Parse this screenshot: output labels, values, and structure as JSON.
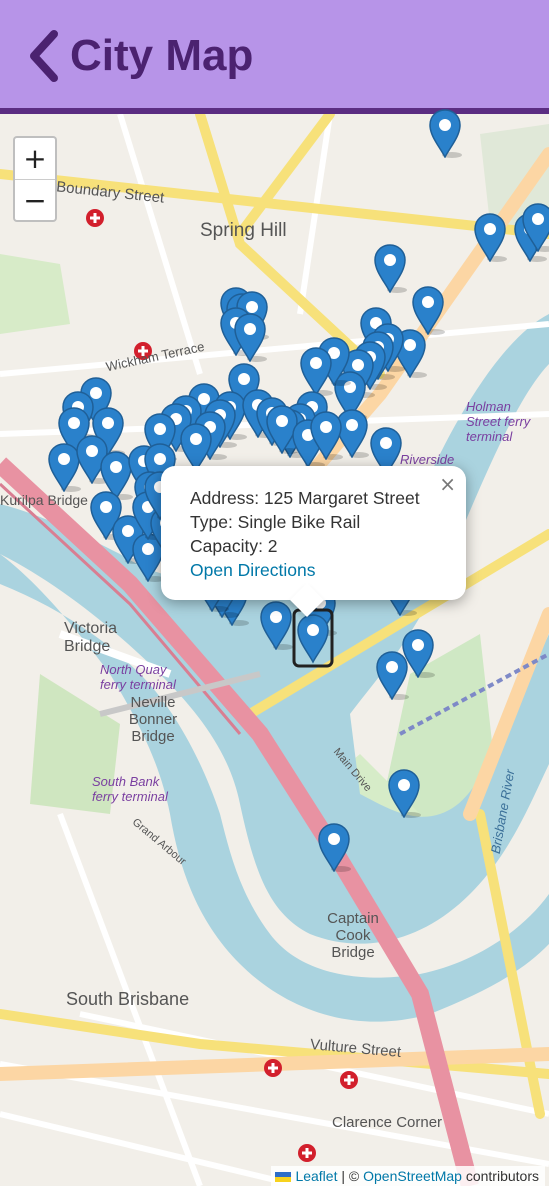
{
  "header": {
    "title": "City Map",
    "back_icon": "chevron-left-icon"
  },
  "zoom": {
    "in_label": "+",
    "out_label": "−"
  },
  "popup": {
    "address": "Address: 125 Margaret Street",
    "type": "Type: Single Bike Rail",
    "capacity": "Capacity: 2",
    "link": "Open Directions",
    "close": "×"
  },
  "map_labels": {
    "spring_hill": "Spring Hill",
    "boundary_street": "Boundary Street",
    "wickham_terrace": "Wickham Terrace",
    "victoria_bridge": "Victoria Bridge",
    "neville_bonner": "Neville Bonner Bridge",
    "north_quay": "North Quay ferry terminal",
    "south_bank": "South Bank ferry terminal",
    "holman": "Holman Street ferry terminal",
    "captain_cook": "Captain Cook Bridge",
    "south_brisbane": "South Brisbane",
    "vulture_street": "Vulture Street",
    "clarence_corner": "Clarence Corner",
    "kurilpa": "Kurilpa Bridge",
    "brisbane_river": "Brisbane River",
    "main_drive": "Main Drive",
    "grand_arbour": "Grand Arbour",
    "riverside": "Riverside"
  },
  "attribution": {
    "leaflet": "Leaflet",
    "separator": " | © ",
    "osm": "OpenStreetMap",
    "suffix": " contributors"
  },
  "colors": {
    "header_bg": "#b794e8",
    "accent": "#5b2d82",
    "marker": "#2a81cb",
    "water": "#aad3df",
    "road": "#f6dba3",
    "highway": "#e892a2"
  }
}
